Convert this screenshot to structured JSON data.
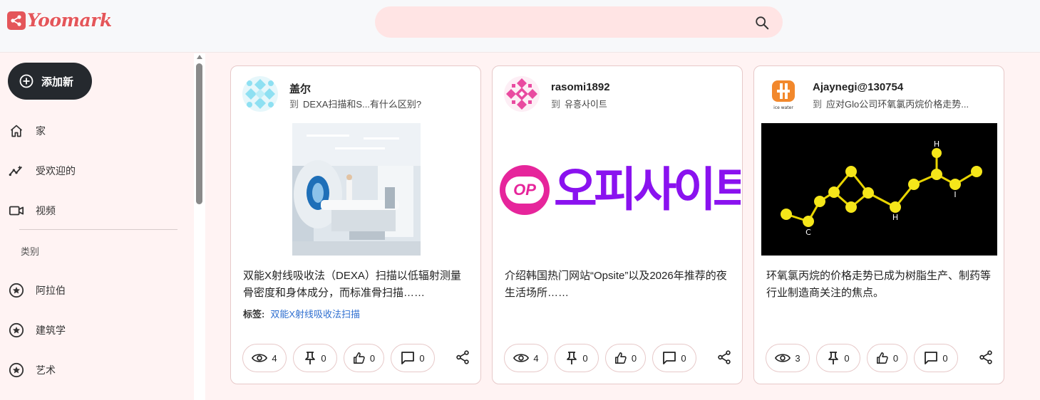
{
  "brand": {
    "name": "Yoomark",
    "color": "#e4565a"
  },
  "search": {
    "placeholder": "",
    "icon": "search-icon"
  },
  "sidebar": {
    "add_button": "添加新",
    "items": [
      {
        "label": "家",
        "icon": "home-icon"
      },
      {
        "label": "受欢迎的",
        "icon": "trending-icon"
      },
      {
        "label": "视频",
        "icon": "video-icon"
      }
    ],
    "categories_title": "类别",
    "categories": [
      {
        "label": "阿拉伯",
        "icon": "star-icon"
      },
      {
        "label": "建筑学",
        "icon": "star-icon"
      },
      {
        "label": "艺术",
        "icon": "star-icon"
      }
    ]
  },
  "cards": [
    {
      "author": "盖尔",
      "to": "到",
      "target": "DEXA扫描和S...有什么区别?",
      "description": "双能X射线吸收法（DEXA）扫描以低辐射测量骨密度和身体成分，而标准骨扫描……",
      "tags_label": "标签:",
      "tag": "双能X射线吸收法扫描",
      "views": "4",
      "pins": "0",
      "likes": "0",
      "comments": "0"
    },
    {
      "author": "rasomi1892",
      "to": "到",
      "target": "유흥사이트",
      "media_badge": "OP",
      "media_text": "오피사이트",
      "description": "介绍韩国热门网站“Opsite”以及2026年推荐的夜生活场所……",
      "views": "4",
      "pins": "0",
      "likes": "0",
      "comments": "0"
    },
    {
      "author": "Ajaynegi@130754",
      "to": "到",
      "target": "应对Glo公司环氧氯丙烷价格走势...",
      "avatar_caption": "ice water",
      "molecule_labels": [
        "H",
        "H",
        "I",
        "C"
      ],
      "description": "环氧氯丙烷的价格走势已成为树脂生产、制药等行业制造商关注的焦点。",
      "views": "3",
      "pins": "0",
      "likes": "0",
      "comments": "0"
    }
  ]
}
